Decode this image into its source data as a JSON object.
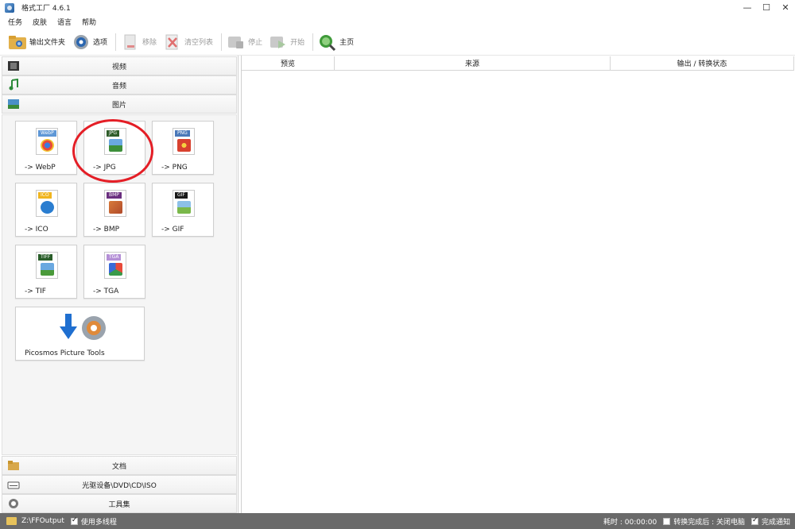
{
  "window": {
    "title": "格式工厂 4.6.1",
    "controls": [
      "—",
      "☐",
      "✕"
    ]
  },
  "menu": [
    "任务",
    "皮肤",
    "语言",
    "帮助"
  ],
  "toolbar": {
    "output_folder": "输出文件夹",
    "options": "选项",
    "remove": "移除",
    "clear_list": "清空列表",
    "stop": "停止",
    "start": "开始",
    "home": "主页"
  },
  "categories": {
    "video": "视频",
    "audio": "音频",
    "picture": "图片",
    "document": "文档",
    "rom": "光驱设备\\DVD\\CD\\ISO",
    "tools": "工具集"
  },
  "tiles": [
    {
      "tag": "WebP",
      "label": "-> WebP",
      "tag_color": "#5e97d6"
    },
    {
      "tag": "JPG",
      "label": "-> JPG",
      "tag_color": "#2f5d2a"
    },
    {
      "tag": "PNG",
      "label": "-> PNG",
      "tag_color": "#4a78b8"
    },
    {
      "tag": "ICO",
      "label": "-> ICO",
      "tag_color": "#f0b51f"
    },
    {
      "tag": "BMP",
      "label": "-> BMP",
      "tag_color": "#6a2f7f"
    },
    {
      "tag": "GIF",
      "label": "-> GIF",
      "tag_color": "#1a1a1a"
    },
    {
      "tag": "TIFF",
      "label": "-> TIF",
      "tag_color": "#2a5e2a"
    },
    {
      "tag": "TGA",
      "label": "-> TGA",
      "tag_color": "#b48fd6"
    },
    {
      "tag": "",
      "label": "Picosmos Picture Tools",
      "tag_color": ""
    }
  ],
  "columns": [
    "预览",
    "来源",
    "输出 / 转换状态"
  ],
  "status": {
    "path": "Z:\\FFOutput",
    "multithread": "使用多线程",
    "elapsed": "耗时 : 00:00:00",
    "after_done": "转换完成后 : 关闭电脑",
    "notify": "完成通知"
  },
  "colors": {
    "statusbar": "#6a6a6a",
    "annotation_circle": "#e41e26"
  }
}
